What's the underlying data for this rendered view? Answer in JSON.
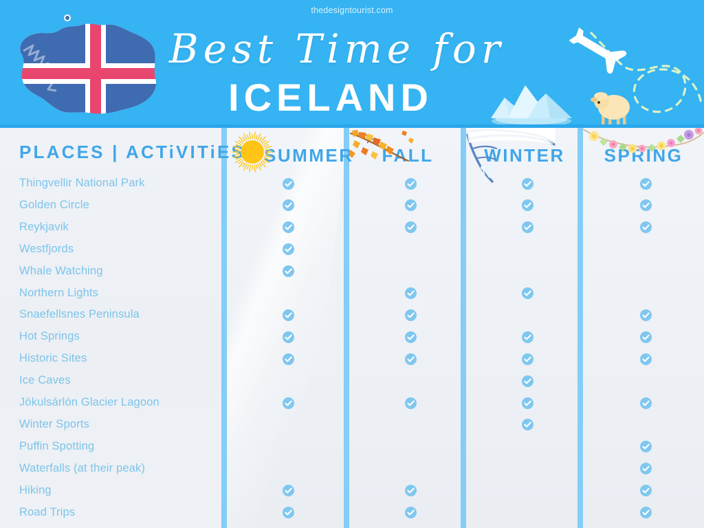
{
  "header": {
    "site_url": "thedesigntourist.com",
    "title_script": "Best Time for",
    "title_main": "ICELAND",
    "background_color": "#35b3f2",
    "icons": [
      "iceland-map-flag",
      "airplane",
      "dotted-flight-path",
      "iceberg",
      "sheep"
    ]
  },
  "table": {
    "row_header_label": "PLACES | ACTiVITiES",
    "accent_color": "#41a6e8",
    "check_color": "#7fc7ef",
    "divider_color": "#84cdf7",
    "columns": [
      {
        "label": "SUMMER",
        "decor": "sun-icon"
      },
      {
        "label": "FALL",
        "decor": "autumn-branch-icon"
      },
      {
        "label": "WINTER",
        "decor": "snowy-branch-icon"
      },
      {
        "label": "SPRING",
        "decor": "flower-garland-icon"
      }
    ],
    "rows": [
      {
        "label": "Thingvellir National Park",
        "checks": [
          true,
          true,
          true,
          true
        ]
      },
      {
        "label": "Golden Circle",
        "checks": [
          true,
          true,
          true,
          true
        ]
      },
      {
        "label": "Reykjavik",
        "checks": [
          true,
          true,
          true,
          true
        ]
      },
      {
        "label": "Westfjords",
        "checks": [
          true,
          false,
          false,
          false
        ]
      },
      {
        "label": "Whale Watching",
        "checks": [
          true,
          false,
          false,
          false
        ]
      },
      {
        "label": "Northern Lights",
        "checks": [
          false,
          true,
          true,
          false
        ]
      },
      {
        "label": "Snaefellsnes Peninsula",
        "checks": [
          true,
          true,
          false,
          true
        ]
      },
      {
        "label": "Hot Springs",
        "checks": [
          true,
          true,
          true,
          true
        ]
      },
      {
        "label": "Historic Sites",
        "checks": [
          true,
          true,
          true,
          true
        ]
      },
      {
        "label": "Ice Caves",
        "checks": [
          false,
          false,
          true,
          false
        ]
      },
      {
        "label": "Jökulsárlón Glacier Lagoon",
        "checks": [
          true,
          true,
          true,
          true
        ]
      },
      {
        "label": "Winter Sports",
        "checks": [
          false,
          false,
          true,
          false
        ]
      },
      {
        "label": "Puffin Spotting",
        "checks": [
          false,
          false,
          false,
          true
        ]
      },
      {
        "label": "Waterfalls (at their peak)",
        "checks": [
          false,
          false,
          false,
          true
        ]
      },
      {
        "label": "Hiking",
        "checks": [
          true,
          true,
          false,
          true
        ]
      },
      {
        "label": "Road Trips",
        "checks": [
          true,
          true,
          false,
          true
        ]
      }
    ]
  }
}
